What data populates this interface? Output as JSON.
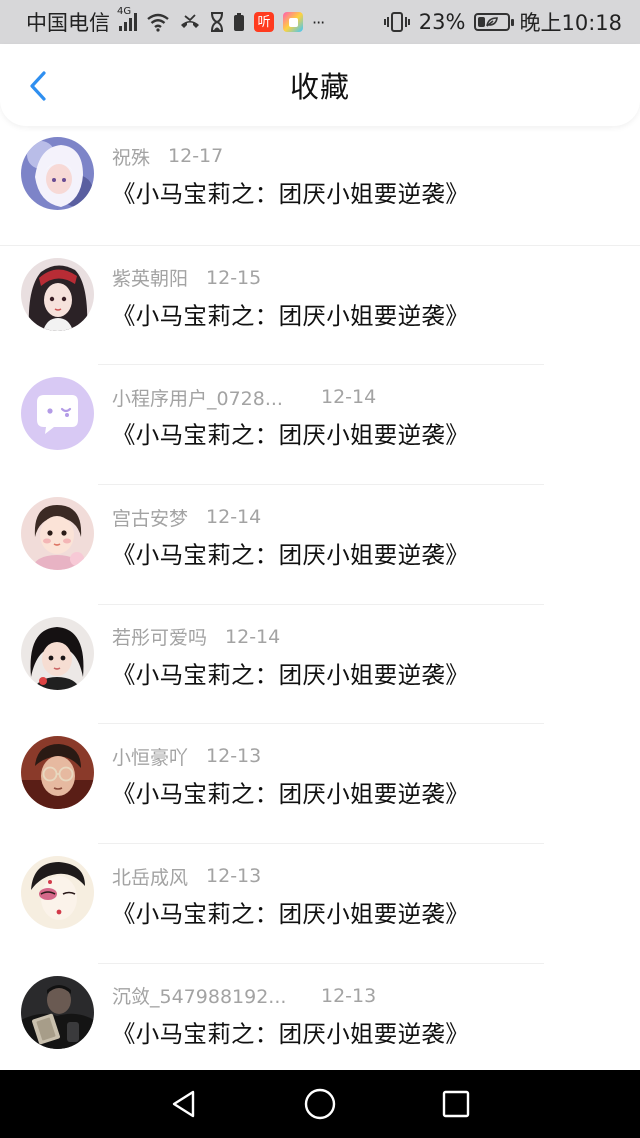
{
  "status_bar": {
    "carrier": "中国电信",
    "network_type": "4G",
    "battery_percent": "23%",
    "battery_level": 0.23,
    "time": "晚上10:18",
    "icons": [
      "signal-icon",
      "wifi-icon",
      "missed-call-icon",
      "hourglass-icon",
      "battery-saver-icon",
      "ting-app-icon",
      "colorful-app-icon",
      "more-icon",
      "vibrate-icon",
      "battery-icon"
    ],
    "ting_label": "听",
    "more_label": "···"
  },
  "header": {
    "title": "收藏",
    "back_icon": "chevron-left-icon",
    "accent_color": "#2f8ff0"
  },
  "favorites": [
    {
      "user": "祝殊",
      "date": "12-17",
      "book": "《小马宝莉之：团厌小姐要逆袭》",
      "avatar": "anime-girl-white-hair"
    },
    {
      "user": "紫英朝阳",
      "date": "12-15",
      "book": "《小马宝莉之：团厌小姐要逆袭》",
      "avatar": "anime-girl-red-hat"
    },
    {
      "user": "小程序用户_0728...",
      "date": "12-14",
      "book": "《小马宝莉之：团厌小姐要逆袭》",
      "avatar": "chat-bubble-default"
    },
    {
      "user": "宫古安梦",
      "date": "12-14",
      "book": "《小马宝莉之：团厌小姐要逆袭》",
      "avatar": "baby-photo"
    },
    {
      "user": "若彤可爱吗",
      "date": "12-14",
      "book": "《小马宝莉之：团厌小姐要逆袭》",
      "avatar": "girl-black-hair"
    },
    {
      "user": "小恒豪吖",
      "date": "12-13",
      "book": "《小马宝莉之：团厌小姐要逆袭》",
      "avatar": "boy-glasses"
    },
    {
      "user": "北岳成风",
      "date": "12-13",
      "book": "《小马宝莉之：团厌小姐要逆袭》",
      "avatar": "painted-face"
    },
    {
      "user": "沉敛_547988192...",
      "date": "12-13",
      "book": "《小马宝莉之：团厌小姐要逆袭》",
      "avatar": "man-holding-cash"
    }
  ],
  "nav_bar": {
    "back_icon": "triangle-back-icon",
    "home_icon": "circle-home-icon",
    "recents_icon": "square-recents-icon"
  }
}
